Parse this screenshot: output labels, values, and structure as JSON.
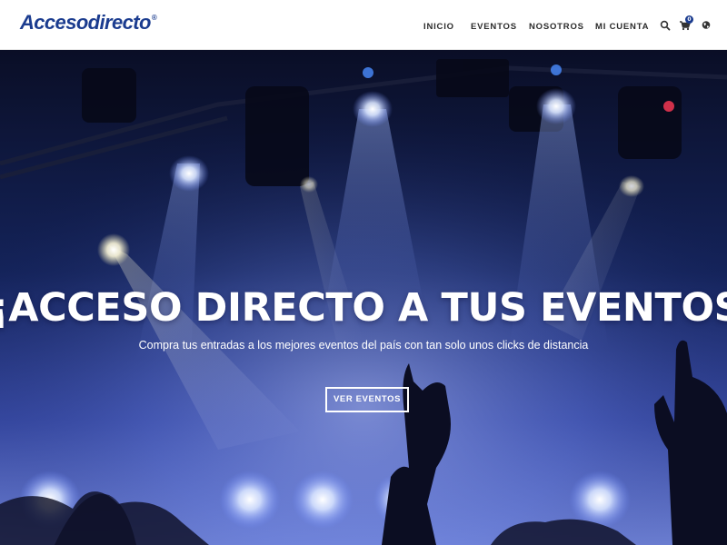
{
  "header": {
    "logo": "Accesodirecto",
    "logo_mark": "®",
    "nav": [
      {
        "label": "INICIO"
      },
      {
        "label": "EVENTOS"
      },
      {
        "label": "NOSOTROS"
      },
      {
        "label": "MI CUENTA"
      }
    ],
    "icons": [
      "search-icon",
      "cart-icon",
      "globe-icon"
    ],
    "cart_count": "0",
    "brand_color": "#1b3c8f"
  },
  "hero": {
    "title": "¡ACCESO DIRECTO A TUS EVENTOS!",
    "subtitle": "Compra tus entradas a los mejores eventos del país con tan solo unos clicks de distancia",
    "button_label": "VER EVENTOS",
    "background": "concert stage lights with raised hands"
  }
}
